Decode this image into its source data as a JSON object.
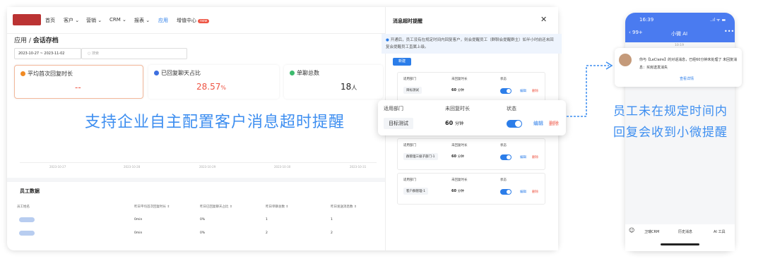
{
  "nav": {
    "items": [
      "首页",
      "客户 ⌄",
      "营销 ⌄",
      "CRM ⌄",
      "报表 ⌄",
      "应用",
      "增值中心"
    ],
    "badge": "new"
  },
  "breadcrumb": {
    "root": "应用 /",
    "current": "会话存档"
  },
  "filters": {
    "date_range": "2023-10-27  ~  2023-11-02",
    "search_placeholder": "搜索"
  },
  "cards": [
    {
      "title": "平均首次回复时长",
      "value": "--",
      "color": "#f08a24"
    },
    {
      "title": "已回复聊天占比",
      "value": "28.57",
      "unit": "%",
      "color": "#3d6fe0"
    },
    {
      "title": "单聊总数",
      "value": "18",
      "unit": "人",
      "color": "#3dbb6e"
    }
  ],
  "chart": {
    "x_ticks": [
      "2023-10-27",
      "2023-10-28",
      "2023-10-29",
      "2023-10-30",
      "2023-10-31"
    ]
  },
  "staff": {
    "title": "员工数据",
    "columns": [
      "员工姓名",
      "昨日平均首次回复时长 ⇕",
      "昨日已回复聊天占比 ⇕",
      "昨日单聊总数 ⇕",
      "昨日发送消息数 ⇕"
    ],
    "rows": [
      [
        "",
        "0min",
        "0%",
        "1",
        "1"
      ],
      [
        "",
        "0min",
        "0%",
        "2",
        "2"
      ]
    ]
  },
  "panel": {
    "title": "消息超时提醒",
    "close": "✕",
    "note": "开通后，员工没有在规定时间内回复客户，则会提醒员工（群聊会提醒群主）如半小时前还未回复会提醒员工直属上级。",
    "new_button": "新建",
    "labels": {
      "dept": "适用部门",
      "time": "未回复时长",
      "status": "状态",
      "edit": "编辑",
      "delete": "删除"
    },
    "rules": [
      {
        "dept": "目标测试",
        "value": "60",
        "unit": "分钟"
      },
      {
        "dept": "目标测试",
        "value": "60",
        "unit": "分钟"
      },
      {
        "dept": "群管理三级子部门-1",
        "value": "60",
        "unit": "分钟"
      },
      {
        "dept": "客户群管理-1",
        "value": "60",
        "unit": "分钟"
      }
    ]
  },
  "headline": "支持企业自主配置客户消息超时提醒",
  "side_text": [
    "员工未在规定时间内",
    "回复会收到小微提醒"
  ],
  "phone": {
    "time": "16:39",
    "signal": "..ıl ᯤ ▬",
    "back": "‹ 99+",
    "title": "小微 AI",
    "more": "•••",
    "date": "10:19",
    "message": "你与【LeClaire】的对话消息，已经60分钟未处理了 未回复消息：买房送发消失",
    "link": "查看详情",
    "bottom": [
      "卫瑞CRM",
      "历史消息",
      "AI 工具"
    ]
  }
}
